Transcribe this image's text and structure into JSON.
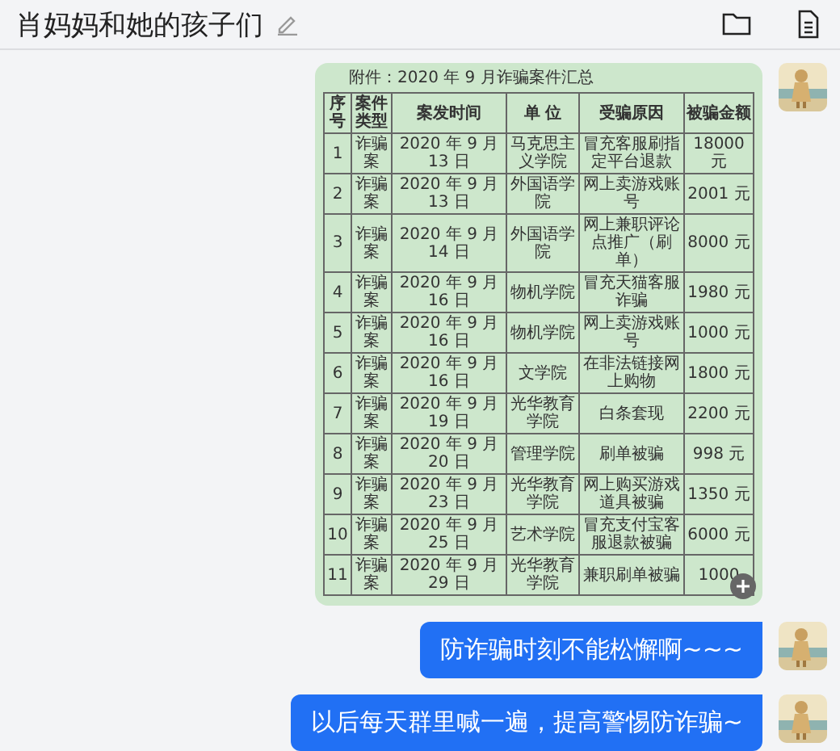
{
  "header": {
    "title": "肖妈妈和她的孩子们"
  },
  "messages": [
    {
      "kind": "document",
      "document": {
        "title": "附件：2020 年 9 月诈骗案件汇总",
        "columns": [
          "序号",
          "案件类型",
          "案发时间",
          "单 位",
          "受骗原因",
          "被骗金额"
        ],
        "rows": [
          [
            "1",
            "诈骗案",
            "2020 年 9 月 13 日",
            "马克思主义学院",
            "冒充客服刷指定平台退款",
            "18000 元"
          ],
          [
            "2",
            "诈骗案",
            "2020 年 9 月 13 日",
            "外国语学院",
            "网上卖游戏账号",
            "2001 元"
          ],
          [
            "3",
            "诈骗案",
            "2020 年 9 月 14 日",
            "外国语学院",
            "网上兼职评论点推广（刷单）",
            "8000 元"
          ],
          [
            "4",
            "诈骗案",
            "2020 年 9 月 16 日",
            "物机学院",
            "冒充天猫客服诈骗",
            "1980 元"
          ],
          [
            "5",
            "诈骗案",
            "2020 年 9 月 16 日",
            "物机学院",
            "网上卖游戏账号",
            "1000 元"
          ],
          [
            "6",
            "诈骗案",
            "2020 年 9 月 16 日",
            "文学院",
            "在非法链接网上购物",
            "1800 元"
          ],
          [
            "7",
            "诈骗案",
            "2020 年 9 月 19 日",
            "光华教育学院",
            "白条套现",
            "2200 元"
          ],
          [
            "8",
            "诈骗案",
            "2020 年 9 月 20 日",
            "管理学院",
            "刷单被骗",
            "998 元"
          ],
          [
            "9",
            "诈骗案",
            "2020 年 9 月 23 日",
            "光华教育学院",
            "网上购买游戏道具被骗",
            "1350 元"
          ],
          [
            "10",
            "诈骗案",
            "2020 年 9 月 25 日",
            "艺术学院",
            "冒充支付宝客服退款被骗",
            "6000 元"
          ],
          [
            "11",
            "诈骗案",
            "2020 年 9 月 29 日",
            "光华教育学院",
            "兼职刷单被骗",
            "1000"
          ]
        ]
      }
    },
    {
      "kind": "text",
      "text": "防诈骗时刻不能松懈啊~~~"
    },
    {
      "kind": "text",
      "text": "以后每天群里喊一遍，提高警惕防诈骗~"
    }
  ]
}
